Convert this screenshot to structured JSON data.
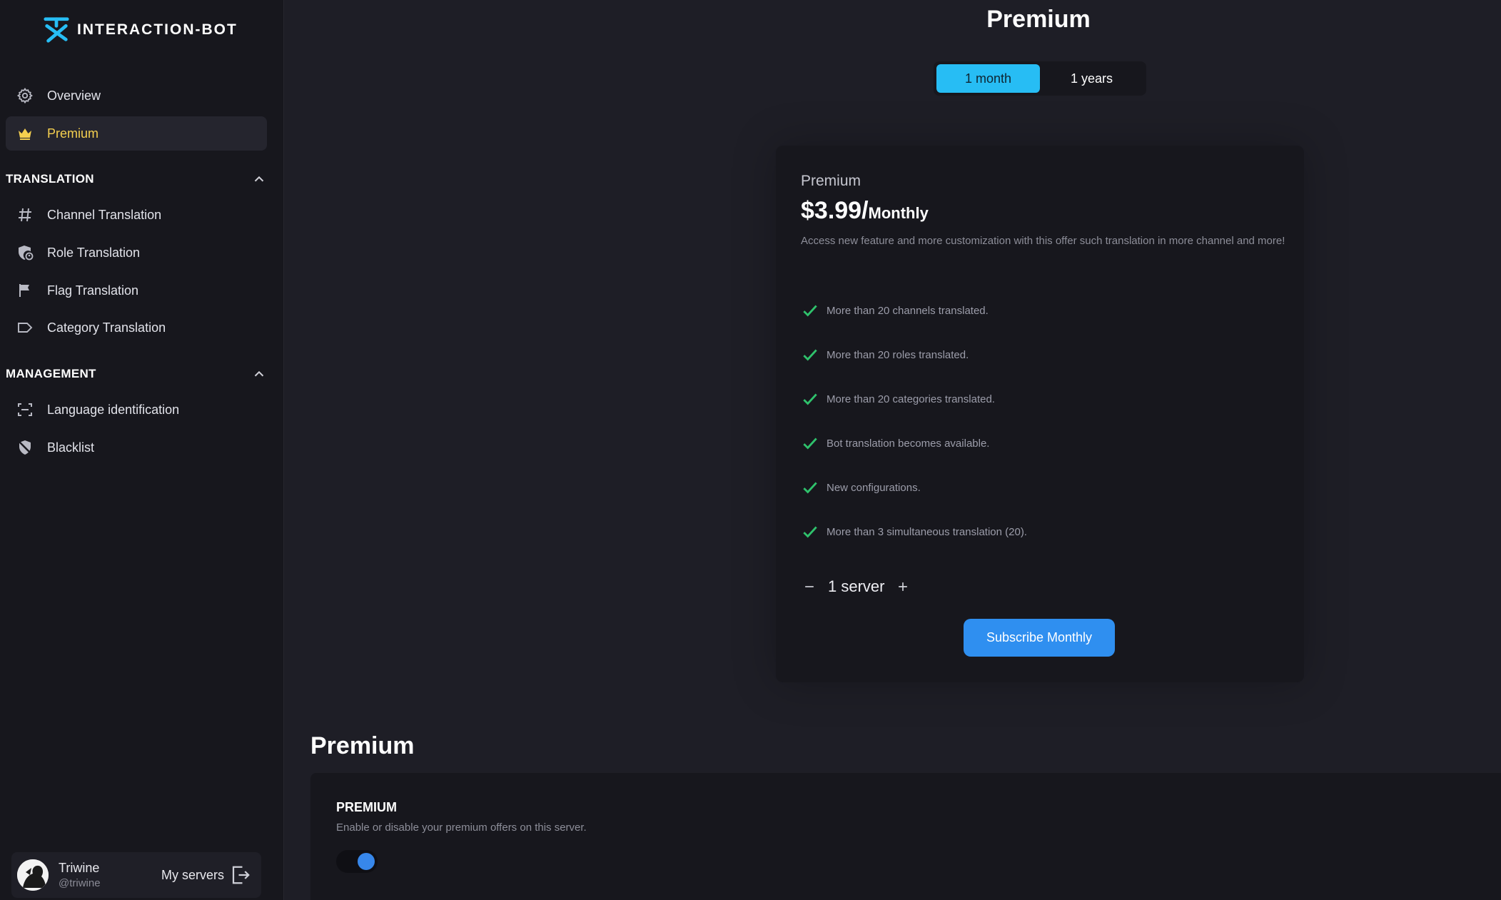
{
  "brand": {
    "name": "INTERACTION-BOT"
  },
  "sidebar": {
    "top_items": [
      {
        "label": "Overview",
        "icon": "gear-icon"
      },
      {
        "label": "Premium",
        "icon": "crown-icon",
        "active": true
      }
    ],
    "sections": [
      {
        "title": "TRANSLATION",
        "items": [
          {
            "label": "Channel Translation",
            "icon": "hash-icon"
          },
          {
            "label": "Role Translation",
            "icon": "role-shield-icon"
          },
          {
            "label": "Flag Translation",
            "icon": "flag-icon"
          },
          {
            "label": "Category Translation",
            "icon": "tag-icon"
          }
        ]
      },
      {
        "title": "MANAGEMENT",
        "items": [
          {
            "label": "Language identification",
            "icon": "scan-icon"
          },
          {
            "label": "Blacklist",
            "icon": "shield-off-icon"
          }
        ]
      }
    ],
    "user": {
      "name": "Triwine",
      "handle": "@triwine",
      "my_servers_label": "My servers"
    }
  },
  "main": {
    "title": "Premium",
    "period_options": [
      "1 month",
      "1 years"
    ],
    "selected_period": "1 month",
    "plan": {
      "name": "Premium",
      "price": "$3.99/",
      "period": "Monthly",
      "description": "Access new feature and more customization with this offer such translation in more channel and more!",
      "features": [
        "More than 20 channels translated.",
        "More than 20 roles translated.",
        "More than 20 categories translated.",
        "Bot translation becomes available.",
        "New configurations.",
        "More than 3 simultaneous translation (20)."
      ],
      "quantity": "1 server",
      "subscribe_label": "Subscribe Monthly"
    },
    "premium_section": {
      "title": "Premium",
      "setting_label": "PREMIUM",
      "setting_help": "Enable or disable your premium offers on this server.",
      "enabled": true
    }
  },
  "colors": {
    "accent_active": "#f4cf4f",
    "toggle_active": "#27bdf4",
    "button": "#2f8ff0",
    "check": "#2fc26c"
  }
}
